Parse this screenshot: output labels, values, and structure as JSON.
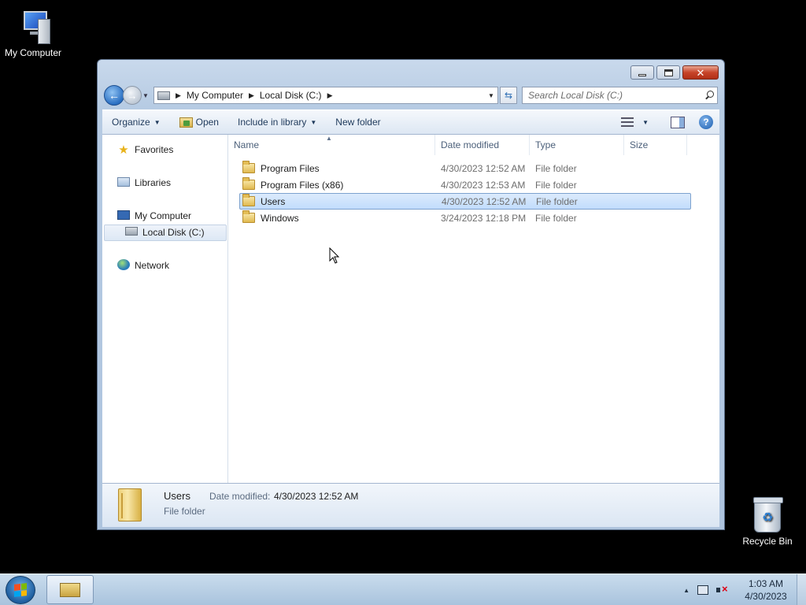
{
  "desktop": {
    "my_computer_label": "My Computer",
    "recycle_bin_label": "Recycle Bin"
  },
  "window": {
    "address": {
      "crumbs": [
        "My Computer",
        "Local Disk (C:)"
      ]
    },
    "search": {
      "placeholder": "Search Local Disk (C:)"
    },
    "toolbar": {
      "organize": "Organize",
      "open": "Open",
      "include_in_library": "Include in library",
      "new_folder": "New folder"
    },
    "nav_pane": {
      "favorites": "Favorites",
      "libraries": "Libraries",
      "my_computer": "My Computer",
      "local_disk": "Local Disk (C:)",
      "network": "Network"
    },
    "columns": {
      "name": "Name",
      "date_modified": "Date modified",
      "type": "Type",
      "size": "Size"
    },
    "files": [
      {
        "name": "Program Files",
        "date": "4/30/2023 12:52 AM",
        "type": "File folder"
      },
      {
        "name": "Program Files (x86)",
        "date": "4/30/2023 12:53 AM",
        "type": "File folder"
      },
      {
        "name": "Users",
        "date": "4/30/2023 12:52 AM",
        "type": "File folder",
        "selected": true
      },
      {
        "name": "Windows",
        "date": "3/24/2023 12:18 PM",
        "type": "File folder"
      }
    ],
    "details": {
      "name": "Users",
      "type": "File folder",
      "date_label": "Date modified:",
      "date_value": "4/30/2023 12:52 AM"
    }
  },
  "taskbar": {
    "time": "1:03 AM",
    "date": "4/30/2023"
  },
  "colors": {
    "selection_fill": "#c1dcfc",
    "selection_border": "#7da2ce",
    "taskbar": "#b9d0e6"
  }
}
